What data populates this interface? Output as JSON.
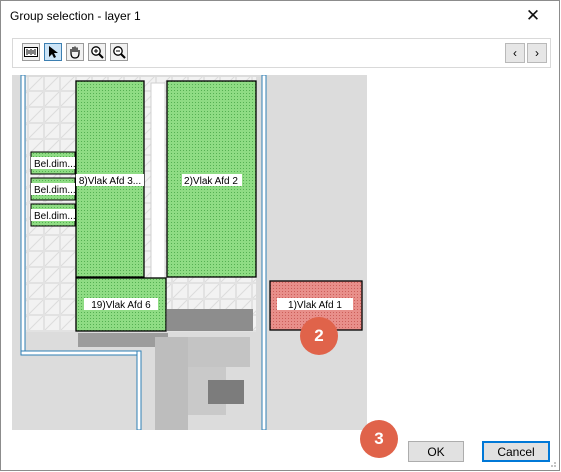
{
  "window": {
    "title": "Group selection - layer 1",
    "close_glyph": "✕"
  },
  "toolbar": {
    "tools": [
      "scale-icon",
      "pointer-icon",
      "hand-pan-icon",
      "zoom-in-icon",
      "zoom-out-icon"
    ],
    "prev_glyph": "‹",
    "next_glyph": "›"
  },
  "drawing": {
    "areas": [
      {
        "label": "8)Vlak Afd 3...",
        "color": "#7ed37a"
      },
      {
        "label": "2)Vlak Afd 2",
        "color": "#7ed37a"
      },
      {
        "label": "19)Vlak Afd 6",
        "color": "#7ed37a"
      },
      {
        "label": "1)Vlak Afd 1",
        "color": "#e07a73",
        "selected": true
      }
    ],
    "dim_labels": [
      "Bel.dim...",
      "Bel.dim...",
      "Bel.dim..."
    ]
  },
  "callouts": [
    "2",
    "3"
  ],
  "buttons": {
    "ok": "OK",
    "cancel": "Cancel"
  }
}
